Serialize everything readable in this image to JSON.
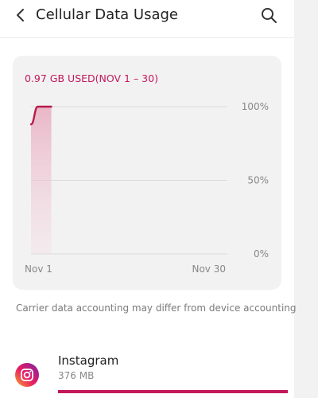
{
  "header": {
    "title": "Cellular Data Usage",
    "back_icon": "chevron-left-icon",
    "search_icon": "search-icon"
  },
  "usage_card": {
    "summary": "0.97 GB USED(NOV 1 – 30)"
  },
  "chart_data": {
    "type": "area",
    "y_tick_labels": [
      "100%",
      "50%",
      "0%"
    ],
    "x_tick_labels": [
      "Nov 1",
      "Nov 30"
    ],
    "x": [
      1,
      2,
      3,
      4
    ],
    "y": [
      88,
      100,
      100,
      100
    ],
    "ylim": [
      0,
      100
    ],
    "xlim": [
      1,
      30
    ],
    "grid": true,
    "color": "#b71c4a"
  },
  "note": "Carrier data accounting may differ from device accounting",
  "apps": [
    {
      "name": "Instagram",
      "size": "376 MB",
      "icon": "instagram-icon",
      "usage_fraction": 1.0
    }
  ],
  "colors": {
    "accent": "#c2185b",
    "card_background": "#f2f2f2"
  }
}
